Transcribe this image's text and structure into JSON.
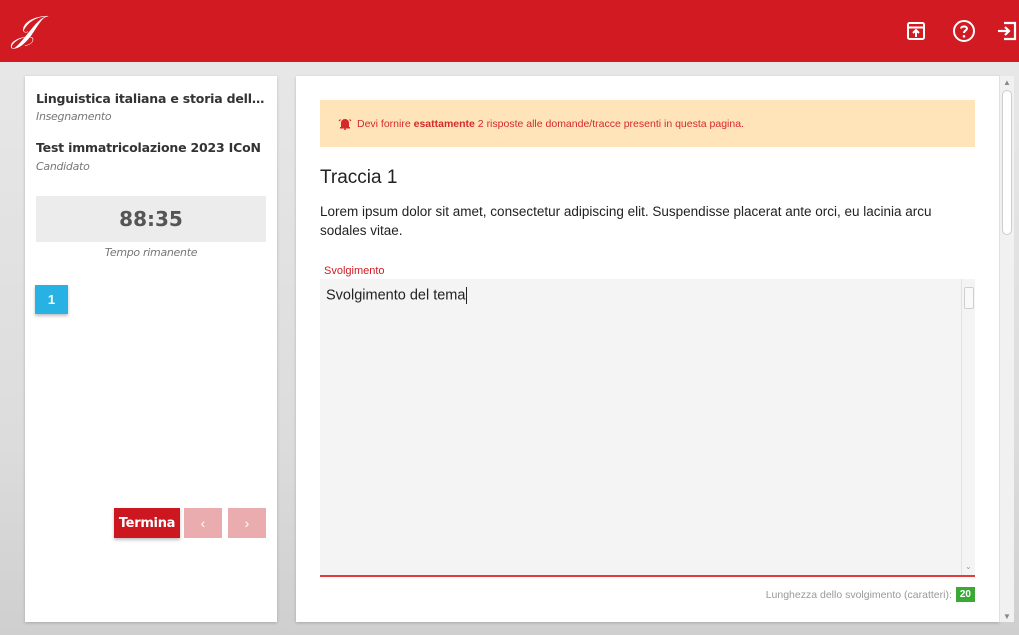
{
  "header": {
    "logo_text": "𝒥",
    "icons": [
      "upload-icon",
      "help-icon",
      "logout-icon"
    ],
    "brand_color": "#d11a22"
  },
  "sidebar": {
    "course_title": "Linguistica italiana e storia della lingua...",
    "course_label": "Insegnamento",
    "candidate_title": "Test immatricolazione 2023 ICoN",
    "candidate_label": "Candidato",
    "timer": "88:35",
    "timer_label": "Tempo rimanente",
    "page_number": "1",
    "finish_label": "Termina",
    "prev_symbol": "‹",
    "next_symbol": "›"
  },
  "main": {
    "alert_prefix": "Devi fornire ",
    "alert_bold": "esattamente",
    "alert_suffix": " 2 risposte alle domande/tracce presenti in questa pagina.",
    "track_title": "Traccia 1",
    "track_text": "Lorem ipsum dolor sit amet, consectetur adipiscing elit. Suspendisse placerat ante orci, eu lacinia arcu sodales vitae.",
    "field_label": "Svolgimento",
    "field_value": "Svolgimento del tema",
    "length_label": "Lunghezza dello svolgimento (caratteri):",
    "length_value": "20"
  }
}
